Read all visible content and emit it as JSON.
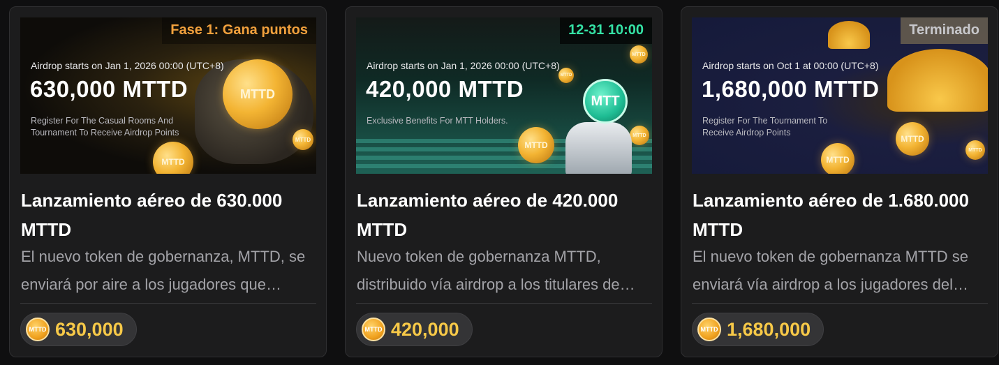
{
  "cards": [
    {
      "tag": "Fase 1: Gana puntos",
      "tag_color": "#f2a13d",
      "banner_line1": "Airdrop starts on Jan 1, 2026 00:00 (UTC+8)",
      "banner_amount": "630,000 MTTD",
      "banner_desc": "Register For The Casual Rooms And Tournament To Receive Airdrop Points",
      "title": "Lanzamiento aéreo de 630.000 MTTD",
      "description": "El nuevo token de gobernanza, MTTD, se enviará por aire a los jugadores que participen en nuestros torneos.",
      "reward_icon": "mttd-coin-icon",
      "reward_icon_label": "MTTD",
      "reward_value": "630,000"
    },
    {
      "tag": "12-31 10:00",
      "tag_color": "#35e3a6",
      "banner_line1": "Airdrop starts on Jan 1, 2026 00:00 (UTC+8)",
      "banner_amount": "420,000 MTTD",
      "banner_desc": "Exclusive Benefits For MTT Holders.",
      "banner_badge": "MTT",
      "title": "Lanzamiento aéreo de 420.000 MTTD",
      "description": "Nuevo token de gobernanza MTTD, distribuido vía airdrop a los titulares de MTT.",
      "reward_icon": "mttd-coin-icon",
      "reward_icon_label": "MTTD",
      "reward_value": "420,000"
    },
    {
      "tag": "Terminado",
      "tag_color": "#c8c8cc",
      "banner_line1": "Airdrop starts on Oct 1 at 00:00 (UTC+8)",
      "banner_amount": "1,680,000 MTTD",
      "banner_desc": "Register For The Tournament To Receive Airdrop Points",
      "title": "Lanzamiento aéreo de 1.680.000 MTTD",
      "description": "El nuevo token de gobernanza MTTD se enviará vía airdrop a los jugadores del torneo.",
      "reward_icon": "mttd-coin-icon",
      "reward_icon_label": "MTTD",
      "reward_value": "1,680,000"
    }
  ],
  "coin_label": "MTTD"
}
